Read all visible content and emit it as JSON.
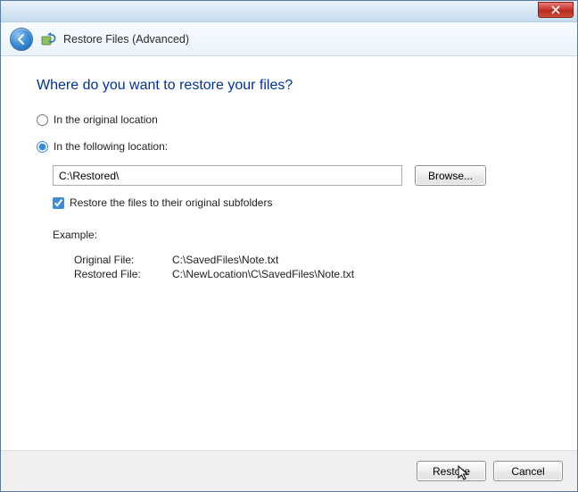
{
  "window": {
    "title": "Restore Files (Advanced)"
  },
  "heading": "Where do you want to restore your files?",
  "options": {
    "original": "In the original location",
    "following": "In the following location:"
  },
  "path": {
    "value": "C:\\Restored\\",
    "browse_label": "Browse..."
  },
  "checkbox": {
    "label": "Restore the files to their original subfolders"
  },
  "example": {
    "heading": "Example:",
    "row1_label": "Original File:",
    "row1_value": "C:\\SavedFiles\\Note.txt",
    "row2_label": "Restored File:",
    "row2_value": "C:\\NewLocation\\C\\SavedFiles\\Note.txt"
  },
  "footer": {
    "restore": "Restore",
    "cancel": "Cancel"
  }
}
